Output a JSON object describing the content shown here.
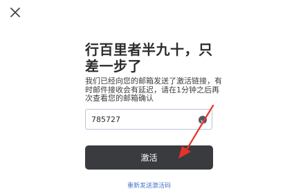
{
  "header": {
    "close_icon": "close-icon"
  },
  "main": {
    "title": "行百里者半九十，只差一步了",
    "description": "我们已经向您的邮箱发送了激活链接，有时邮件接收会有延迟，请在1分钟之后再次查看您的邮箱确认",
    "code_input": {
      "value": "785727",
      "clear_icon": "clear-icon"
    },
    "activate_label": "激活",
    "resend_label": "重新发送激活码"
  },
  "annotation": {
    "arrow_icon": "arrow-icon",
    "color": "#e8312a"
  },
  "colors": {
    "button_bg": "#3a3b3f",
    "link": "#4a76c9",
    "input_border": "#b8c4d6"
  }
}
